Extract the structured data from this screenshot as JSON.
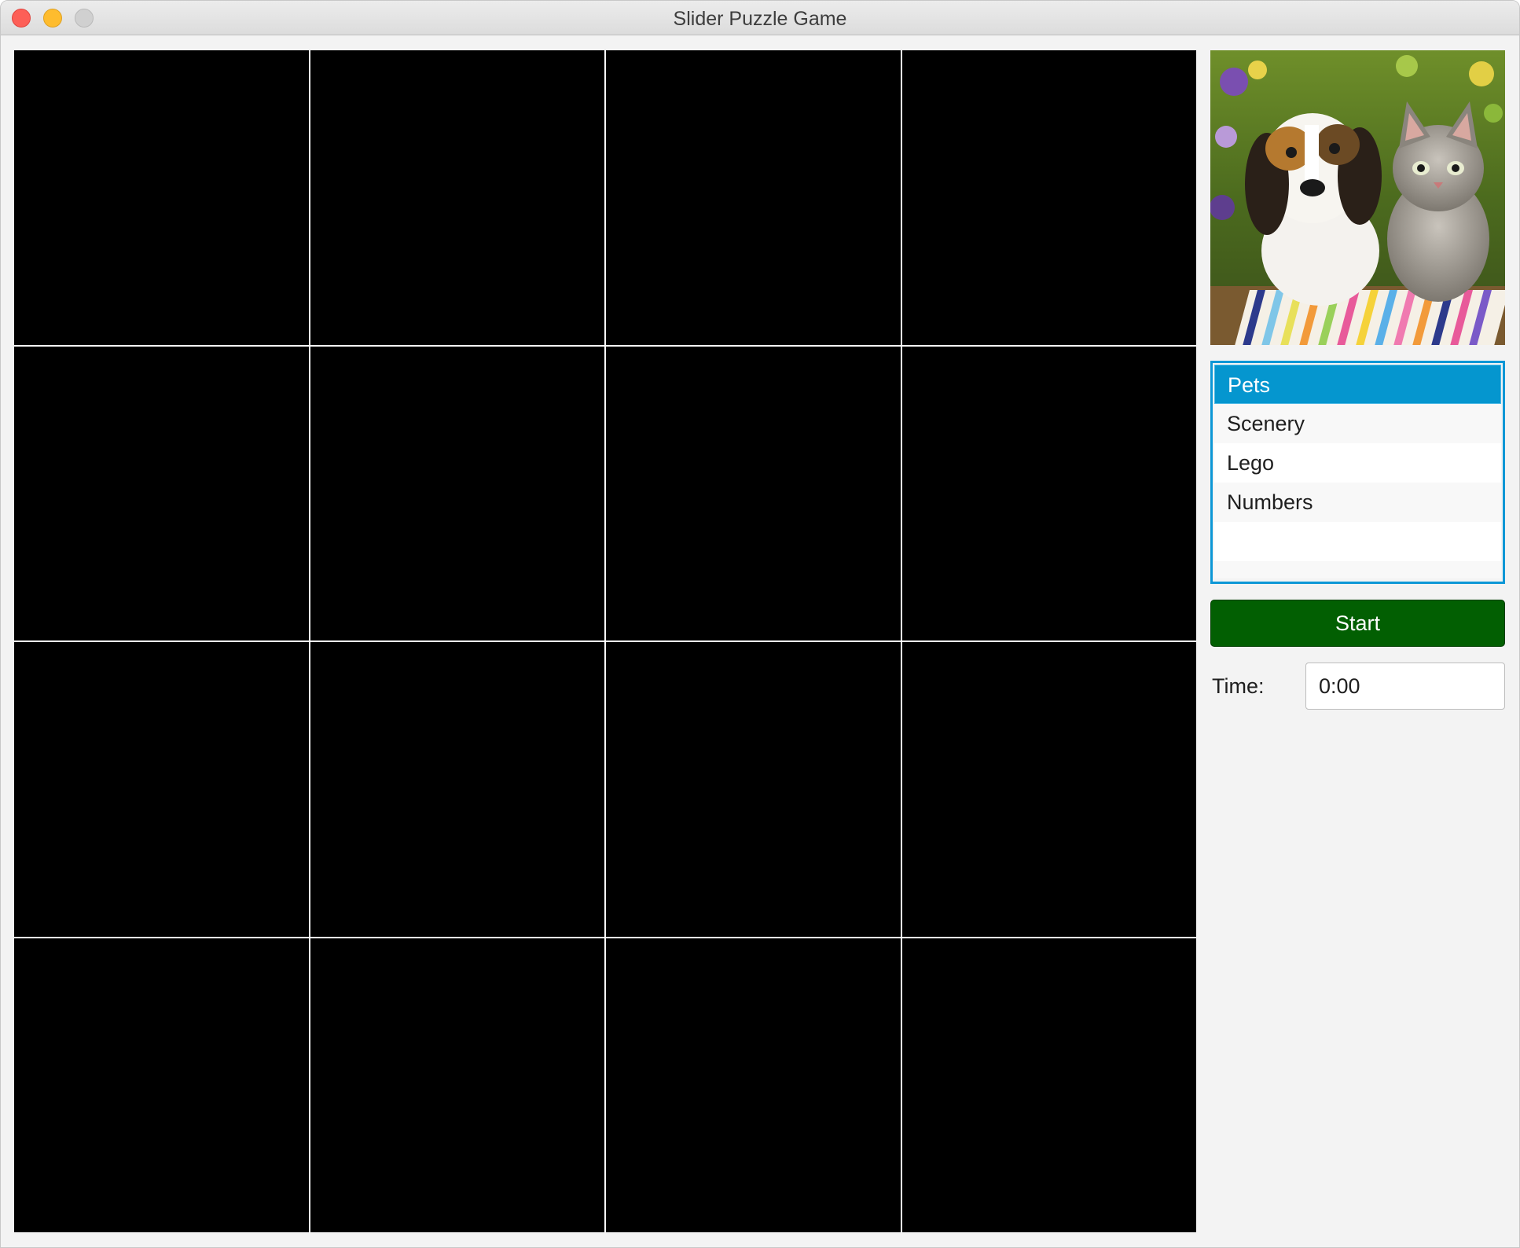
{
  "window": {
    "title": "Slider Puzzle Game"
  },
  "board": {
    "rows": 4,
    "columns": 4,
    "tile_color": "#000000"
  },
  "sidebar": {
    "preview_image": "puppy and kitten on striped blanket",
    "categories": [
      {
        "label": "Pets",
        "selected": true
      },
      {
        "label": "Scenery",
        "selected": false
      },
      {
        "label": "Lego",
        "selected": false
      },
      {
        "label": "Numbers",
        "selected": false
      }
    ],
    "start_label": "Start",
    "time_label": "Time:",
    "time_value": "0:00"
  },
  "colors": {
    "accent": "#0596cf",
    "start_button": "#025f02"
  }
}
